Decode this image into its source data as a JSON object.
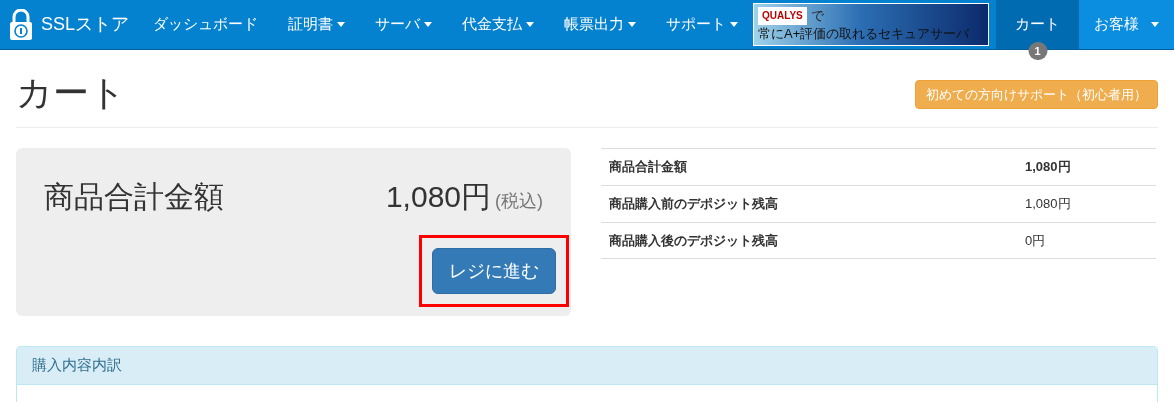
{
  "navbar": {
    "brand": "SSLストア",
    "items": [
      {
        "label": "ダッシュボード",
        "dropdown": false,
        "selected": false
      },
      {
        "label": "証明書",
        "dropdown": true,
        "selected": false
      },
      {
        "label": "サーバ",
        "dropdown": true,
        "selected": false
      },
      {
        "label": "代金支払",
        "dropdown": true,
        "selected": false
      },
      {
        "label": "帳票出力",
        "dropdown": true,
        "selected": false
      },
      {
        "label": "サポート",
        "dropdown": true,
        "selected": false
      }
    ],
    "banner": {
      "logo": "QUALYS",
      "line_1": "で",
      "line_2": "常にA+評価の取れるセキュアサーバ"
    },
    "cart": {
      "label": "カート",
      "selected": true,
      "badge": "1"
    },
    "account": {
      "label": "お客様",
      "dropdown": true,
      "selected": false
    }
  },
  "page": {
    "title": "カート",
    "help_button": "初めての方向けサポート（初心者用）"
  },
  "summary": {
    "label": "商品合計金額",
    "amount": "1,080円",
    "tax_note": "(税込)",
    "checkout_button": "レジに進む",
    "highlighted": true
  },
  "balance_table": [
    {
      "label": "商品合計金額",
      "value": "1,080円",
      "emphasis": true
    },
    {
      "label": "商品購入前のデポジット残高",
      "value": "1,080円",
      "emphasis": false
    },
    {
      "label": "商品購入後のデポジット残高",
      "value": "0円",
      "emphasis": false
    }
  ],
  "details_panel": {
    "title": "購入内容内訳"
  }
}
